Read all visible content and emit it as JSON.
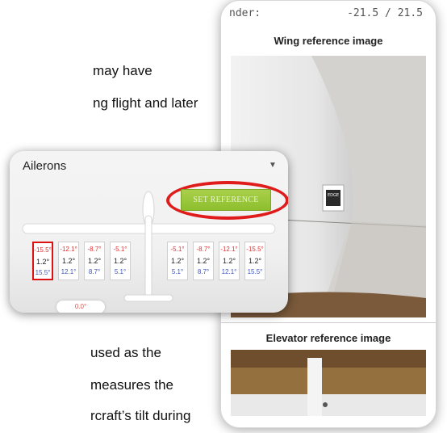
{
  "document": {
    "lines": [
      "may have",
      "ng flight and later",
      "used as the",
      "measures the",
      "rcraft’s tilt during"
    ]
  },
  "phone": {
    "readout_label": "nder:",
    "readout_value": "-21.5 / 21.5",
    "wing_title": "Wing reference image",
    "elevator_title": "Elevator reference image",
    "sticker_text": "EDGE"
  },
  "ailerons": {
    "title": "Ailerons",
    "set_reference_label": "SET REFERENCE",
    "bottom_value": "0.0°",
    "left_cells": [
      {
        "top": "-15.5°",
        "mid": "1.2°",
        "bot": "15.5°"
      },
      {
        "top": "-12.1°",
        "mid": "1.2°",
        "bot": "12.1°"
      },
      {
        "top": "-8.7°",
        "mid": "1.2°",
        "bot": "8.7°"
      },
      {
        "top": "-5.1°",
        "mid": "1.2°",
        "bot": "5.1°"
      }
    ],
    "right_cells": [
      {
        "top": "-5.1°",
        "mid": "1.2°",
        "bot": "5.1°"
      },
      {
        "top": "-8.7°",
        "mid": "1.2°",
        "bot": "8.7°"
      },
      {
        "top": "-12.1°",
        "mid": "1.2°",
        "bot": "12.1°"
      },
      {
        "top": "-15.5°",
        "mid": "1.2°",
        "bot": "15.5°"
      }
    ]
  },
  "colors": {
    "highlight_ring": "#e01b1b",
    "button_green": "#8dbf2e",
    "negative_value": "#d33",
    "positive_value": "#3d55c0"
  }
}
